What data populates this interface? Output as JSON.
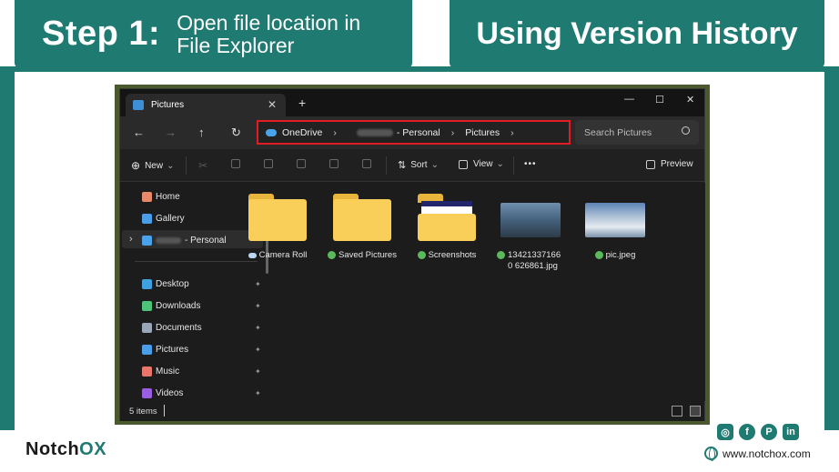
{
  "header": {
    "step_num": "Step 1:",
    "step_desc_line1": "Open file location in",
    "step_desc_line2": "File Explorer",
    "title": "Using Version History"
  },
  "window": {
    "tab_label": "Pictures",
    "tab_close": "✕",
    "new_tab": "+",
    "minimize": "—",
    "maximize": "☐",
    "close": "✕"
  },
  "nav": {
    "back": "←",
    "forward": "→",
    "up": "↑",
    "refresh": "↻",
    "address": {
      "seg1": "OneDrive",
      "seg2": "- Personal",
      "seg3": "Pictures",
      "sep": "›"
    },
    "search_placeholder": "Search Pictures"
  },
  "toolbar": {
    "new_label": "New",
    "sort_label": "Sort",
    "view_label": "View",
    "more": "•••",
    "preview_label": "Preview",
    "caret": "⌄"
  },
  "sidebar": {
    "items": [
      {
        "label": "Home",
        "icon": "home-icon",
        "color": "#e88a6a"
      },
      {
        "label": "Gallery",
        "icon": "gallery-icon",
        "color": "#4a9ee8"
      },
      {
        "label": "- Personal",
        "icon": "onedrive-icon",
        "color": "#4aa3ea"
      },
      {
        "label": "Desktop",
        "icon": "desktop-icon",
        "color": "#3fa1e0"
      },
      {
        "label": "Downloads",
        "icon": "downloads-icon",
        "color": "#4fc37a"
      },
      {
        "label": "Documents",
        "icon": "documents-icon",
        "color": "#9aa7b8"
      },
      {
        "label": "Pictures",
        "icon": "pictures-icon",
        "color": "#4a9ee8"
      },
      {
        "label": "Music",
        "icon": "music-icon",
        "color": "#e8766a"
      },
      {
        "label": "Videos",
        "icon": "videos-icon",
        "color": "#9a5ee0"
      }
    ],
    "pin": "📌",
    "expand": "›"
  },
  "content": {
    "items": [
      {
        "label": "Camera Roll",
        "status": "cloud",
        "type": "folder"
      },
      {
        "label": "Saved Pictures",
        "status": "synced",
        "type": "folder"
      },
      {
        "label": "Screenshots",
        "status": "synced",
        "type": "folder-preview"
      },
      {
        "label": "134213371660 626861.jpg",
        "status": "synced",
        "type": "image"
      },
      {
        "label": "pic.jpeg",
        "status": "synced",
        "type": "image"
      }
    ]
  },
  "status": {
    "count": "5 items"
  },
  "footer": {
    "brand_a": "Notch",
    "brand_b": "OX",
    "website": "www.notchox.com",
    "social": [
      "instagram-icon",
      "facebook-icon",
      "pinterest-icon",
      "linkedin-icon"
    ],
    "social_glyphs": [
      "◎",
      "f",
      "P",
      "in"
    ]
  },
  "colors": {
    "accent": "#1f7a72",
    "highlight": "#e31b23"
  }
}
